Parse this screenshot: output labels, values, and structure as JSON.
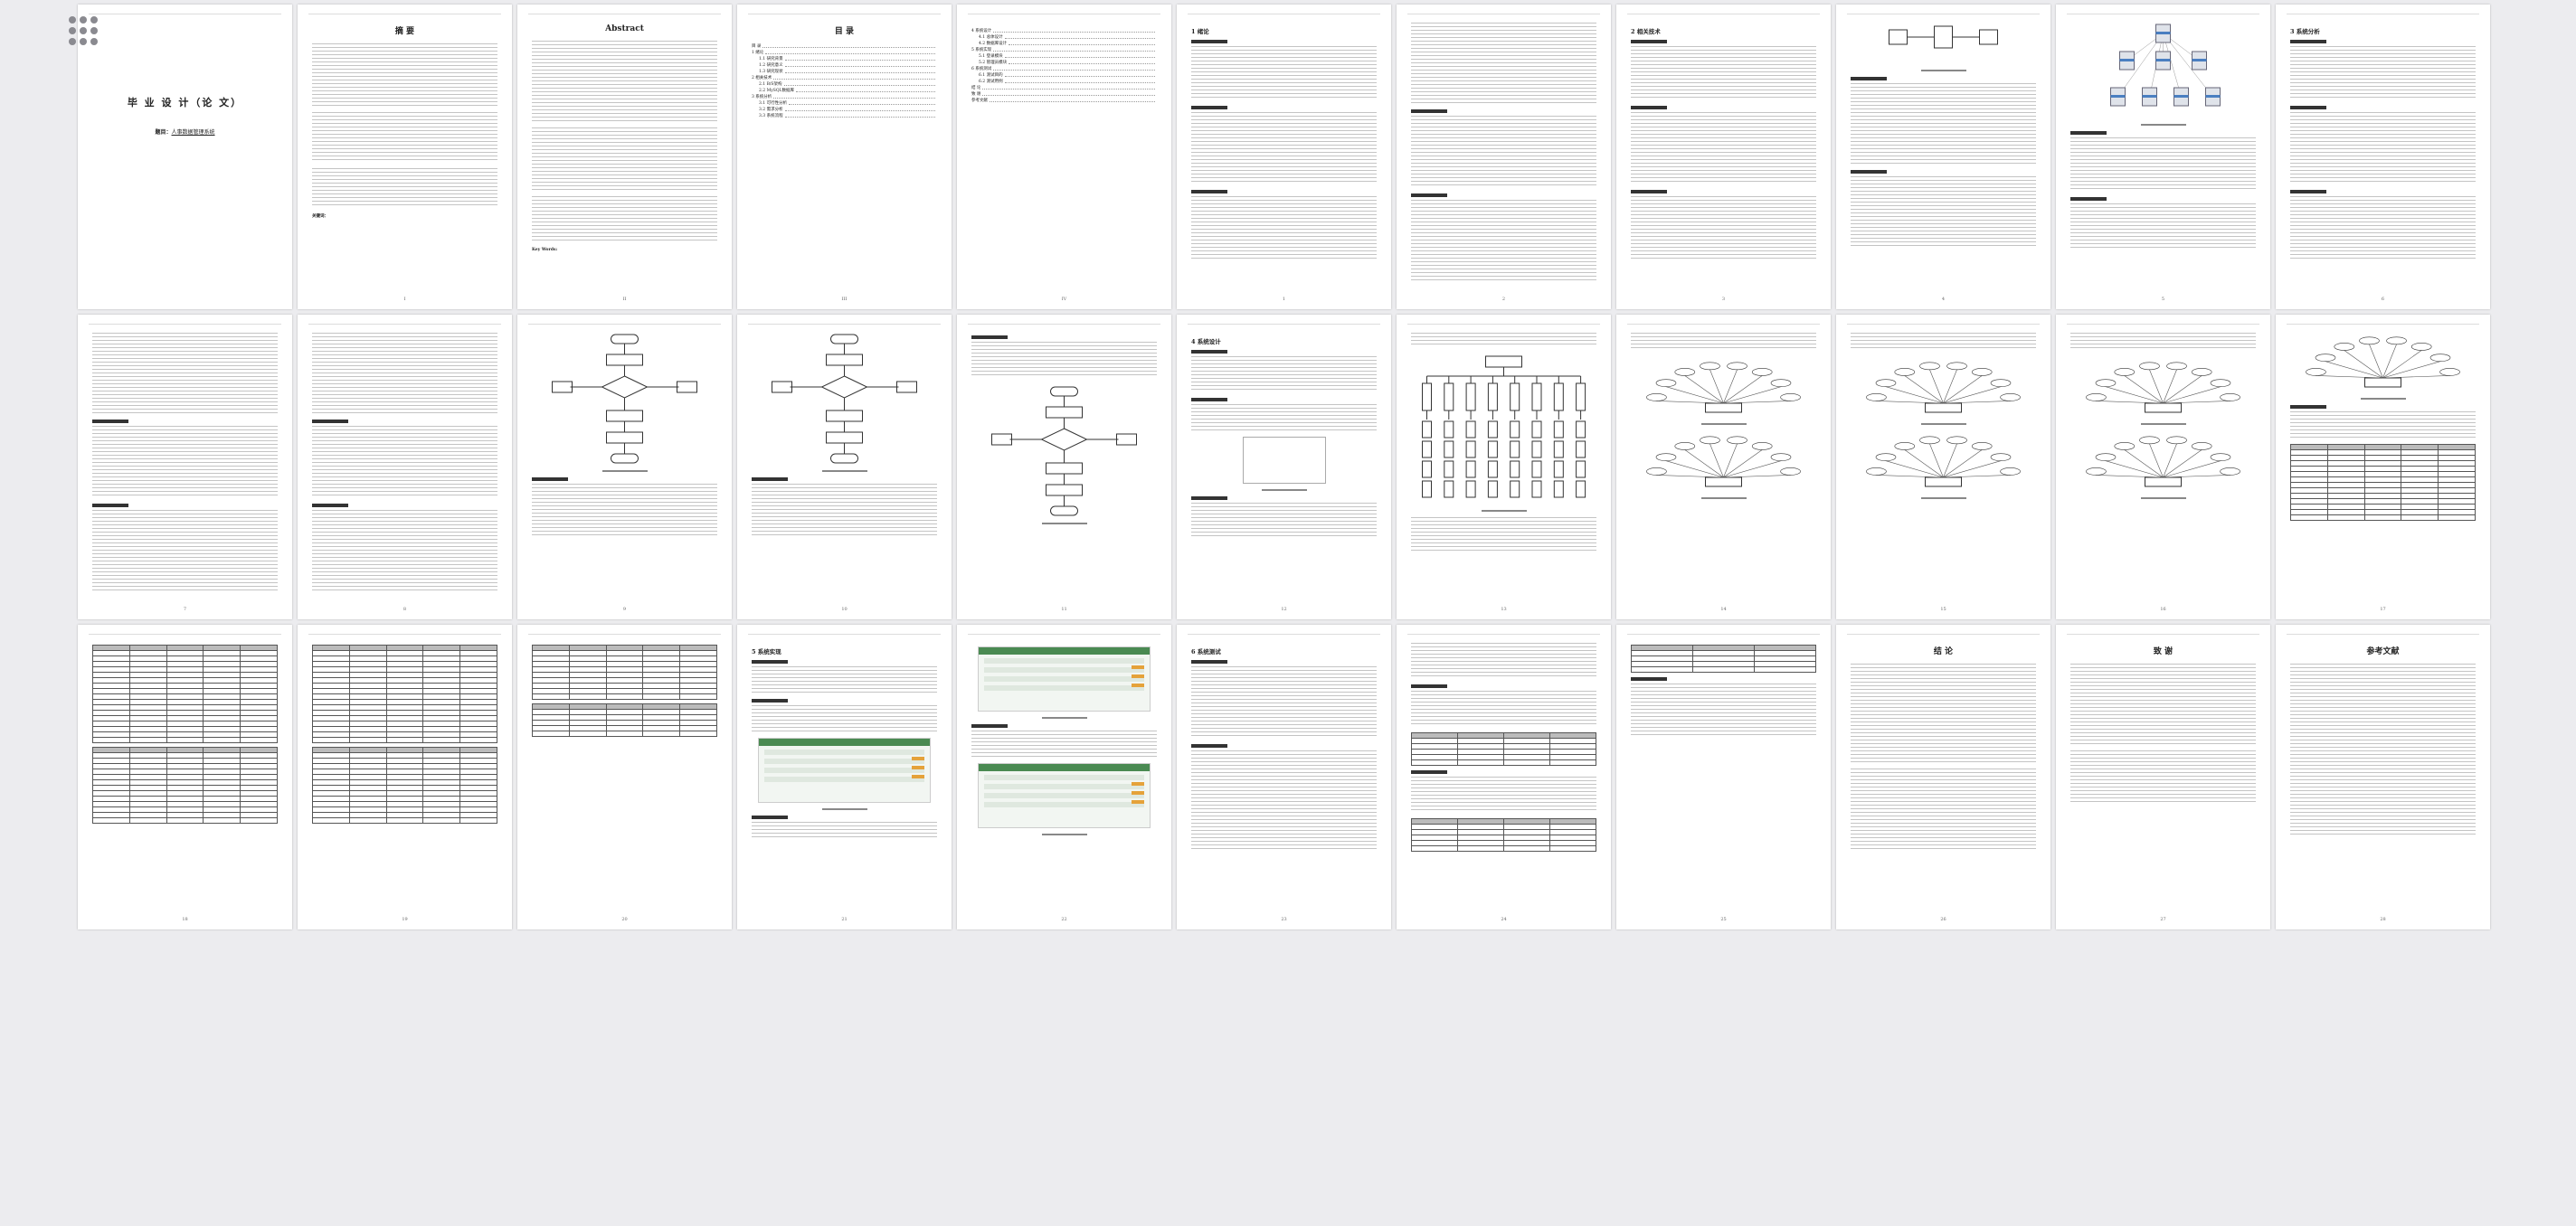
{
  "viewer": {
    "menu_icon": "grid-menu-icon"
  },
  "header_text": "",
  "cover": {
    "title": "毕 业 设 计（论 文）",
    "subtitle_label": "题目：",
    "subtitle_value": "人事数据管理系统"
  },
  "abstract_cn": {
    "title": "摘 要",
    "keywords_label": "关键词："
  },
  "abstract_en": {
    "title": "Abstract",
    "keywords_label": "Key Words:"
  },
  "toc": {
    "title": "目 录",
    "entries": [
      {
        "t": "目 录",
        "lvl": 1
      },
      {
        "t": "1 绪论",
        "lvl": 1
      },
      {
        "t": "1.1 研究背景",
        "lvl": 2
      },
      {
        "t": "1.2 研究意义",
        "lvl": 2
      },
      {
        "t": "1.3 研究现状",
        "lvl": 2
      },
      {
        "t": "2 相关技术",
        "lvl": 1
      },
      {
        "t": "2.1 B/S架构",
        "lvl": 2
      },
      {
        "t": "2.2 MySQL数据库",
        "lvl": 2
      },
      {
        "t": "3 系统分析",
        "lvl": 1
      },
      {
        "t": "3.1 可行性分析",
        "lvl": 2
      },
      {
        "t": "3.2 需求分析",
        "lvl": 2
      },
      {
        "t": "3.3 系统流程",
        "lvl": 2
      }
    ],
    "entries2": [
      {
        "t": "4 系统设计",
        "lvl": 1
      },
      {
        "t": "4.1 总体设计",
        "lvl": 2
      },
      {
        "t": "4.2 数据库设计",
        "lvl": 2
      },
      {
        "t": "5 系统实现",
        "lvl": 1
      },
      {
        "t": "5.1 登录模块",
        "lvl": 2
      },
      {
        "t": "5.2 管理员模块",
        "lvl": 2
      },
      {
        "t": "6 系统测试",
        "lvl": 1
      },
      {
        "t": "6.1 测试目的",
        "lvl": 2
      },
      {
        "t": "6.2 测试用例",
        "lvl": 2
      },
      {
        "t": "结 论",
        "lvl": 1
      },
      {
        "t": "致 谢",
        "lvl": 1
      },
      {
        "t": "参考文献",
        "lvl": 1
      }
    ]
  },
  "headings": {
    "intro": "1 绪论",
    "tech": "2 相关技术",
    "analysis": "3 系统分析",
    "design": "4 系统设计",
    "impl": "5 系统实现",
    "test": "6 系统测试",
    "conclusion": "结 论",
    "thanks": "致 谢",
    "refs": "参考文献"
  },
  "pages": [
    {
      "kind": "cover",
      "n": ""
    },
    {
      "kind": "abs_cn",
      "n": "I"
    },
    {
      "kind": "abs_en",
      "n": "II"
    },
    {
      "kind": "toc1",
      "n": "III"
    },
    {
      "kind": "toc2",
      "n": "IV"
    },
    {
      "kind": "text",
      "h": "intro",
      "n": "1"
    },
    {
      "kind": "text2",
      "n": "2"
    },
    {
      "kind": "text",
      "h": "tech",
      "n": "3"
    },
    {
      "kind": "network",
      "n": "4"
    },
    {
      "kind": "servers",
      "n": "5"
    },
    {
      "kind": "text",
      "h": "analysis",
      "n": "6"
    },
    {
      "kind": "text2",
      "n": "7"
    },
    {
      "kind": "text2",
      "n": "8"
    },
    {
      "kind": "flow",
      "n": "9"
    },
    {
      "kind": "flow",
      "n": "10"
    },
    {
      "kind": "flowsmall",
      "n": "11"
    },
    {
      "kind": "design",
      "n": "12"
    },
    {
      "kind": "tree",
      "n": "13"
    },
    {
      "kind": "er",
      "n": "14"
    },
    {
      "kind": "er",
      "n": "15"
    },
    {
      "kind": "er",
      "n": "16"
    },
    {
      "kind": "ertbl",
      "n": "17"
    },
    {
      "kind": "tbl",
      "n": "18"
    },
    {
      "kind": "tbl",
      "n": "19"
    },
    {
      "kind": "tbl2",
      "n": "20"
    },
    {
      "kind": "impl",
      "n": "21"
    },
    {
      "kind": "shots",
      "n": "22"
    },
    {
      "kind": "testtext",
      "n": "23"
    },
    {
      "kind": "testtbl",
      "n": "24"
    },
    {
      "kind": "smalltbl",
      "n": "25"
    },
    {
      "kind": "concl",
      "n": "26"
    },
    {
      "kind": "thanks",
      "n": "27"
    },
    {
      "kind": "refs",
      "n": "28"
    }
  ]
}
